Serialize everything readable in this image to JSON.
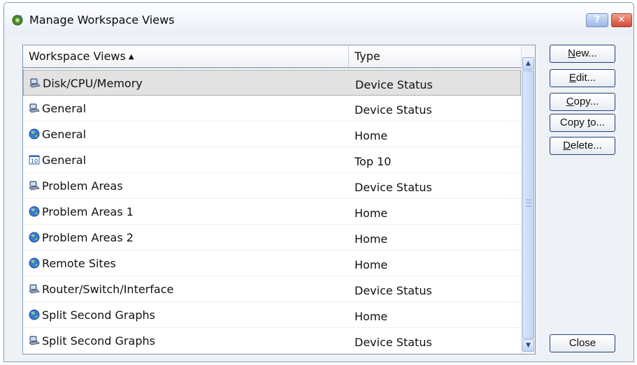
{
  "window": {
    "title": "Manage Workspace Views",
    "help_label": "?",
    "close_label": "✕"
  },
  "list": {
    "columns": [
      {
        "label": "Workspace Views",
        "sort": "ascending"
      },
      {
        "label": "Type"
      }
    ],
    "rows": [
      {
        "name": "Disk/CPU/Memory",
        "type": "Device Status",
        "icon": "device-icon",
        "selected": true
      },
      {
        "name": "General",
        "type": "Device Status",
        "icon": "device-icon"
      },
      {
        "name": "General",
        "type": "Home",
        "icon": "globe-icon"
      },
      {
        "name": "General",
        "type": "Top 10",
        "icon": "top10-icon"
      },
      {
        "name": "Problem Areas",
        "type": "Device Status",
        "icon": "device-icon"
      },
      {
        "name": "Problem Areas 1",
        "type": "Home",
        "icon": "globe-icon"
      },
      {
        "name": "Problem Areas 2",
        "type": "Home",
        "icon": "globe-icon"
      },
      {
        "name": "Remote Sites",
        "type": "Home",
        "icon": "globe-icon"
      },
      {
        "name": "Router/Switch/Interface",
        "type": "Device Status",
        "icon": "device-icon"
      },
      {
        "name": "Split Second Graphs",
        "type": "Home",
        "icon": "globe-icon"
      },
      {
        "name": "Split Second Graphs",
        "type": "Device Status",
        "icon": "device-icon"
      }
    ]
  },
  "buttons": {
    "new": {
      "mnemonic": "N",
      "rest": "ew..."
    },
    "edit": {
      "mnemonic": "E",
      "rest": "dit..."
    },
    "copy": {
      "mnemonic": "C",
      "rest": "opy..."
    },
    "copy_to": {
      "pre": "Copy ",
      "mnemonic": "t",
      "rest": "o..."
    },
    "delete": {
      "mnemonic": "D",
      "rest": "elete..."
    },
    "close": "Close"
  },
  "colors": {
    "accent": "#3a6fd8",
    "selection": "#e2e2e2"
  }
}
